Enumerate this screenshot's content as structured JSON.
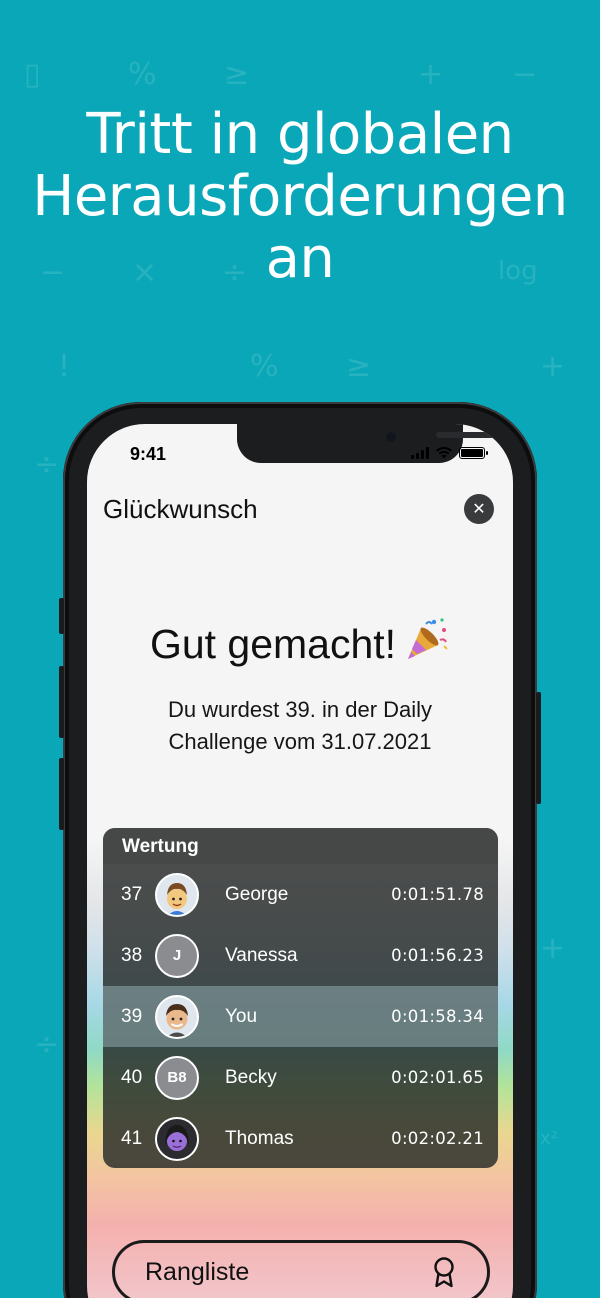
{
  "headline": [
    "Tritt in globalen",
    "Herausforderungen",
    "an"
  ],
  "status_bar": {
    "time": "9:41"
  },
  "modal": {
    "title": "Glückwunsch",
    "close_icon": "close-icon"
  },
  "congrats": {
    "heading": "Gut gemacht!",
    "emoji": "party-popper-icon",
    "line1": "Du wurdest 39. in der Daily",
    "line2": "Challenge vom 31.07.2021"
  },
  "leaderboard": {
    "title": "Wertung",
    "rows": [
      {
        "rank": "37",
        "avatar": "memoji-george",
        "initials": "",
        "name": "George",
        "time": "0:01:51.78",
        "highlight": false
      },
      {
        "rank": "38",
        "avatar": "initials",
        "initials": "J",
        "name": "Vanessa",
        "time": "0:01:56.23",
        "highlight": false
      },
      {
        "rank": "39",
        "avatar": "memoji-you",
        "initials": "",
        "name": "You",
        "time": "0:01:58.34",
        "highlight": true
      },
      {
        "rank": "40",
        "avatar": "initials",
        "initials": "B8",
        "name": "Becky",
        "time": "0:02:01.65",
        "highlight": false
      },
      {
        "rank": "41",
        "avatar": "memoji-thomas",
        "initials": "",
        "name": "Thomas",
        "time": "0:02:02.21",
        "highlight": false
      }
    ]
  },
  "rangliste_button": {
    "label": "Rangliste",
    "icon": "award-ribbon-icon"
  },
  "colors": {
    "background": "#09a7b7",
    "phone_frame": "#1c1d1f",
    "text_dark": "#111111"
  }
}
